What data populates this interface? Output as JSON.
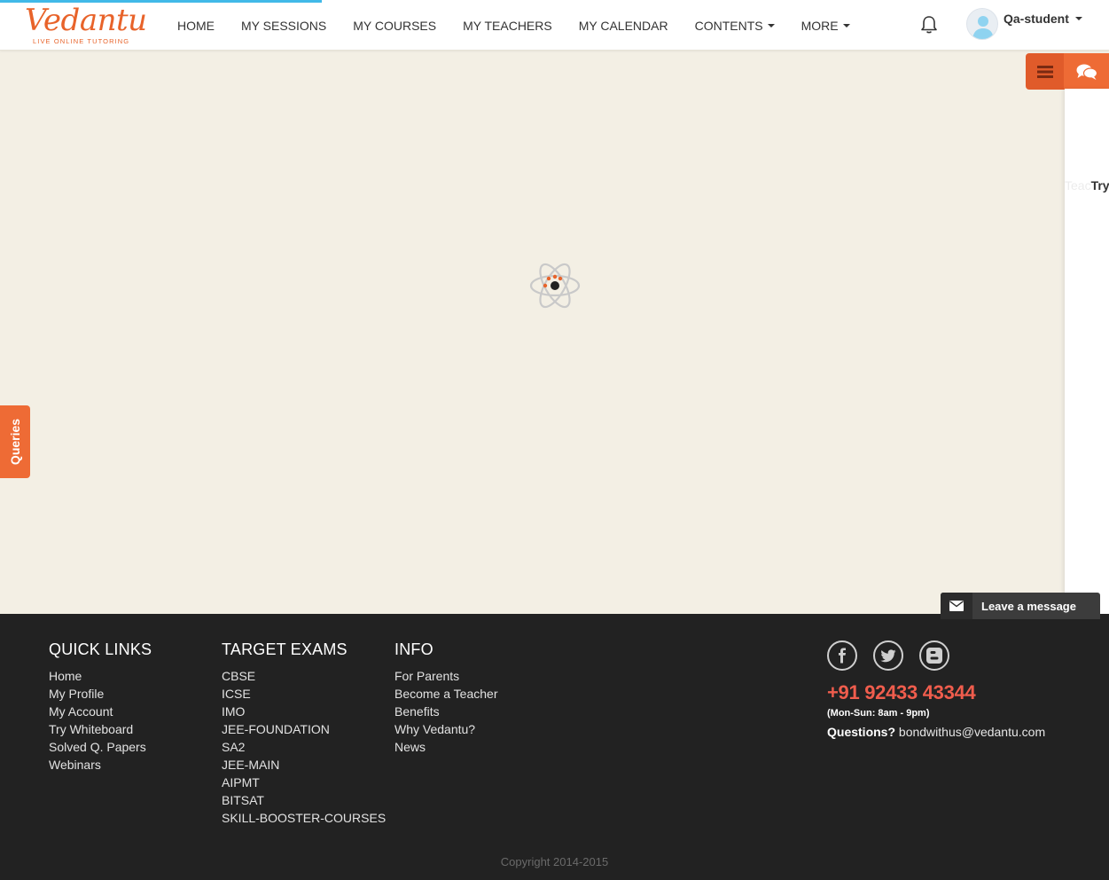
{
  "header": {
    "logo_text": "Vedantu",
    "logo_tagline": "LIVE ONLINE TUTORING",
    "nav": [
      {
        "label": "HOME"
      },
      {
        "label": "MY SESSIONS"
      },
      {
        "label": "MY COURSES"
      },
      {
        "label": "MY TEACHERS"
      },
      {
        "label": "MY CALENDAR"
      },
      {
        "label": "CONTENTS"
      },
      {
        "label": "MORE"
      }
    ],
    "user_name": "Qa-student"
  },
  "side_panel": {
    "peek_faint": "Teac",
    "peek_dark": "Try"
  },
  "queries_tab": {
    "label": "Queries"
  },
  "leave_message": {
    "label": "Leave a message"
  },
  "footer": {
    "quick_links": {
      "title": "QUICK LINKS",
      "items": [
        "Home",
        "My Profile",
        "My Account",
        "Try Whiteboard",
        "Solved Q. Papers",
        "Webinars"
      ]
    },
    "target_exams": {
      "title": "TARGET EXAMS",
      "items": [
        "CBSE",
        "ICSE",
        "IMO",
        "JEE-FOUNDATION",
        "SA2",
        "JEE-MAIN",
        "AIPMT",
        "BITSAT",
        "SKILL-BOOSTER-COURSES"
      ]
    },
    "info": {
      "title": "INFO",
      "items": [
        "For Parents",
        "Become a Teacher",
        "Benefits",
        "Why Vedantu?",
        "News"
      ]
    },
    "phone": "+91 92433 43344",
    "hours": "(Mon-Sun: 8am - 9pm)",
    "questions_label": "Questions?",
    "email": "bondwithus@vedantu.com",
    "copyright": "Copyright 2014-2015"
  },
  "colors": {
    "brand_orange": "#e8632a",
    "progress_blue": "#41b9e8",
    "phone_red": "#f05d4d",
    "page_bg": "#f3efe4",
    "footer_bg": "#222222"
  },
  "icons": {
    "bell": "bell-icon",
    "menu": "hamburger-menu-icon",
    "chat": "chat-bubbles-icon",
    "loader": "atom-loader-icon",
    "envelope": "envelope-icon",
    "facebook": "facebook-icon",
    "twitter": "twitter-icon",
    "blogger": "blogger-icon"
  },
  "progress": {
    "fraction": 0.29
  }
}
